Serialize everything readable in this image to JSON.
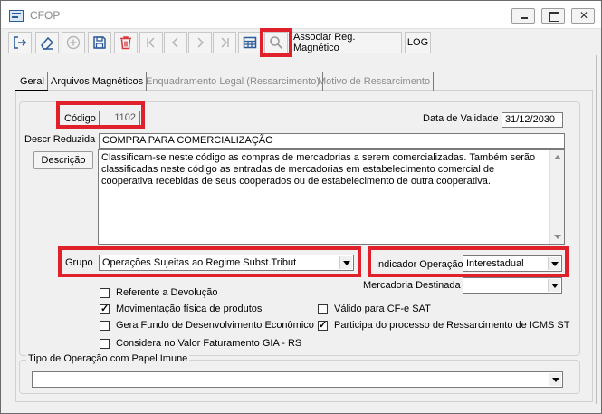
{
  "window": {
    "title": "CFOP"
  },
  "toolbar": {
    "associar_label": "Associar Reg. Magnético",
    "log_label": "LOG",
    "icons": [
      "exit-icon",
      "eraser-icon",
      "add-icon",
      "save-icon",
      "delete-icon",
      "first-icon",
      "prev-icon",
      "next-icon",
      "last-icon",
      "grid-icon",
      "search-icon"
    ]
  },
  "tabs": [
    {
      "label": "Geral",
      "state": "active"
    },
    {
      "label": "Arquivos Magnéticos",
      "state": "enabled"
    },
    {
      "label": "Enquadramento Legal (Ressarcimento)",
      "state": "disabled"
    },
    {
      "label": "Motivo de Ressarcimento",
      "state": "disabled"
    }
  ],
  "form": {
    "codigo_label": "Código",
    "codigo_value": "1102",
    "validade_label": "Data de Validade",
    "validade_value": "31/12/2030",
    "descr_reduzida_label": "Descr Reduzida",
    "descr_reduzida_value": "COMPRA PARA COMERCIALIZAÇÃO",
    "descricao_button": "Descrição",
    "descricao_text": "Classificam-se neste código as compras de mercadorias a serem comercializadas. Também serão classificadas neste código as entradas de mercadorias em estabelecimento comercial de cooperativa recebidas de seus cooperados ou de estabelecimento de outra cooperativa.",
    "grupo_label": "Grupo",
    "grupo_value": "Operações Sujeitas ao Regime Subst.Tribut",
    "indicador_label": "Indicador Operação",
    "indicador_value": "Interestadual",
    "mercadoria_label": "Mercadoria Destinada",
    "mercadoria_value": "",
    "checkboxes": [
      {
        "label": "Referente a Devolução",
        "checked": false
      },
      {
        "label": "Movimentação física de produtos",
        "checked": true
      },
      {
        "label": "Válido para CF-e SAT",
        "checked": false
      },
      {
        "label": "Gera Fundo de Desenvolvimento Econômico",
        "checked": false
      },
      {
        "label": "Participa do processo de Ressarcimento de ICMS ST",
        "checked": true
      },
      {
        "label": "Considera no Valor Faturamento GIA - RS",
        "checked": false
      }
    ],
    "papel_imune_label": "Tipo de Operação com Papel Imune",
    "papel_imune_value": ""
  },
  "colors": {
    "highlight": "#e0202a",
    "delete_icon": "#d9363e",
    "save_icon": "#2a5b9a"
  }
}
